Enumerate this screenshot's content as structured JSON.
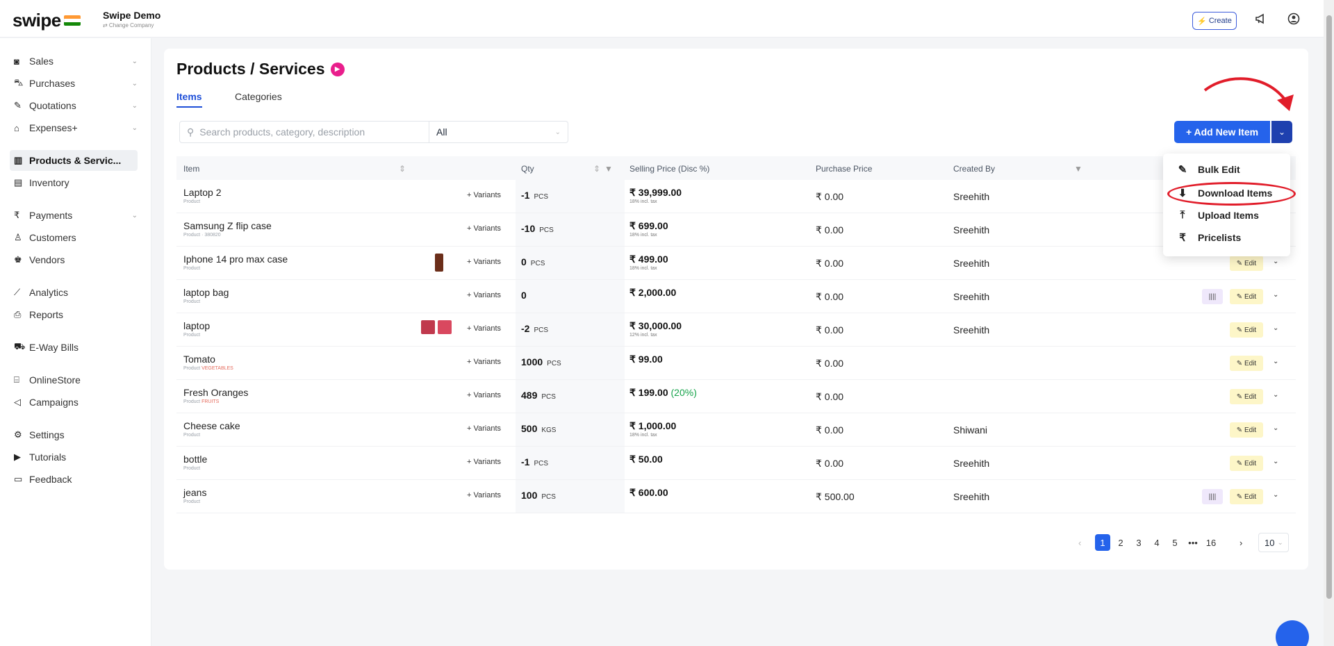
{
  "topbar": {
    "logo": "swipe",
    "company_name": "Swipe Demo",
    "change_company": "⇄ Change Company",
    "create_label": "Create"
  },
  "sidebar": {
    "items": [
      {
        "label": "Sales",
        "icon": "wallet-icon",
        "chevron": true
      },
      {
        "label": "Purchases",
        "icon": "cart-icon",
        "chevron": true
      },
      {
        "label": "Quotations",
        "icon": "pen-icon",
        "chevron": true
      },
      {
        "label": "Expenses+",
        "icon": "tag-icon",
        "chevron": true
      },
      {
        "label": "Products & Servic...",
        "icon": "barcode-icon",
        "active": true
      },
      {
        "label": "Inventory",
        "icon": "inventory-icon"
      },
      {
        "label": "Payments",
        "icon": "rupee-icon",
        "chevron": true
      },
      {
        "label": "Customers",
        "icon": "user-icon"
      },
      {
        "label": "Vendors",
        "icon": "users-icon"
      },
      {
        "label": "Analytics",
        "icon": "chart-icon"
      },
      {
        "label": "Reports",
        "icon": "report-icon"
      },
      {
        "label": "E-Way Bills",
        "icon": "truck-icon"
      },
      {
        "label": "OnlineStore",
        "icon": "store-icon"
      },
      {
        "label": "Campaigns",
        "icon": "megaphone-icon"
      },
      {
        "label": "Settings",
        "icon": "gear-icon"
      },
      {
        "label": "Tutorials",
        "icon": "youtube-icon"
      },
      {
        "label": "Feedback",
        "icon": "feedback-icon"
      }
    ]
  },
  "main": {
    "title": "Products / Services",
    "tabs": [
      "Items",
      "Categories"
    ],
    "search_placeholder": "Search products, category, description",
    "filter_value": "All",
    "add_button": "+ Add New Item",
    "columns": {
      "item": "Item",
      "qty": "Qty",
      "selling": "Selling Price (Disc %)",
      "purchase": "Purchase Price",
      "created": "Created By"
    },
    "variants_label": "+ Variants",
    "edit_label": "Edit",
    "barcode_label": "||||",
    "rows": [
      {
        "name": "Laptop 2",
        "sub": "Product",
        "tag": "",
        "qty": "-1",
        "unit": "PCS",
        "price": "₹ 39,999.00",
        "disc": "",
        "tax": "18% incl. tax",
        "pp": "₹ 0.00",
        "by": "Sreehith",
        "barcode": false
      },
      {
        "name": "Samsung Z flip case",
        "sub": "Product · 380820",
        "tag": "",
        "qty": "-10",
        "unit": "PCS",
        "price": "₹ 699.00",
        "disc": "",
        "tax": "18% incl. tax",
        "pp": "₹ 0.00",
        "by": "Sreehith",
        "barcode": false
      },
      {
        "name": "Iphone 14 pro max case",
        "sub": "Product",
        "tag": "",
        "qty": "0",
        "unit": "PCS",
        "price": "₹ 499.00",
        "disc": "",
        "tax": "18% incl. tax",
        "pp": "₹ 0.00",
        "by": "Sreehith",
        "barcode": false
      },
      {
        "name": "laptop bag",
        "sub": "Product",
        "tag": "",
        "qty": "0",
        "unit": "",
        "price": "₹ 2,000.00",
        "disc": "",
        "tax": "",
        "pp": "₹ 0.00",
        "by": "Sreehith",
        "barcode": true
      },
      {
        "name": "laptop",
        "sub": "Product",
        "tag": "",
        "qty": "-2",
        "unit": "PCS",
        "price": "₹ 30,000.00",
        "disc": "",
        "tax": "12% incl. tax",
        "pp": "₹ 0.00",
        "by": "Sreehith",
        "barcode": false
      },
      {
        "name": "Tomato",
        "sub": "Product",
        "tag": "VEGETABLES",
        "qty": "1000",
        "unit": "PCS",
        "price": "₹ 99.00",
        "disc": "",
        "tax": "",
        "pp": "₹ 0.00",
        "by": "",
        "barcode": false
      },
      {
        "name": "Fresh Oranges",
        "sub": "Product",
        "tag": "FRUITS",
        "qty": "489",
        "unit": "PCS",
        "price": "₹ 199.00",
        "disc": "(20%)",
        "tax": "",
        "pp": "₹ 0.00",
        "by": "",
        "barcode": false
      },
      {
        "name": "Cheese cake",
        "sub": "Product",
        "tag": "",
        "qty": "500",
        "unit": "KGS",
        "price": "₹ 1,000.00",
        "disc": "",
        "tax": "18% incl. tax",
        "pp": "₹ 0.00",
        "by": "Shiwani",
        "barcode": false
      },
      {
        "name": "bottle",
        "sub": "Product",
        "tag": "",
        "qty": "-1",
        "unit": "PCS",
        "price": "₹ 50.00",
        "disc": "",
        "tax": "",
        "pp": "₹ 0.00",
        "by": "Sreehith",
        "barcode": false
      },
      {
        "name": "jeans",
        "sub": "Product",
        "tag": "",
        "qty": "100",
        "unit": "PCS",
        "price": "₹ 600.00",
        "disc": "",
        "tax": "",
        "pp": "₹ 500.00",
        "by": "Sreehith",
        "barcode": true
      }
    ],
    "pagination": {
      "pages": [
        "1",
        "2",
        "3",
        "4",
        "5",
        "•••",
        "16"
      ],
      "current": "1",
      "per_page": "10"
    }
  },
  "dropdown": {
    "items": [
      {
        "label": "Bulk Edit",
        "icon": "edit-icon"
      },
      {
        "label": "Download Items",
        "icon": "download-icon"
      },
      {
        "label": "Upload Items",
        "icon": "upload-icon"
      },
      {
        "label": "Pricelists",
        "icon": "rupee-icon"
      }
    ]
  },
  "colors": {
    "accent": "#2563eb",
    "annotation": "#e11d2a",
    "brand_pink": "#e91e8c"
  }
}
